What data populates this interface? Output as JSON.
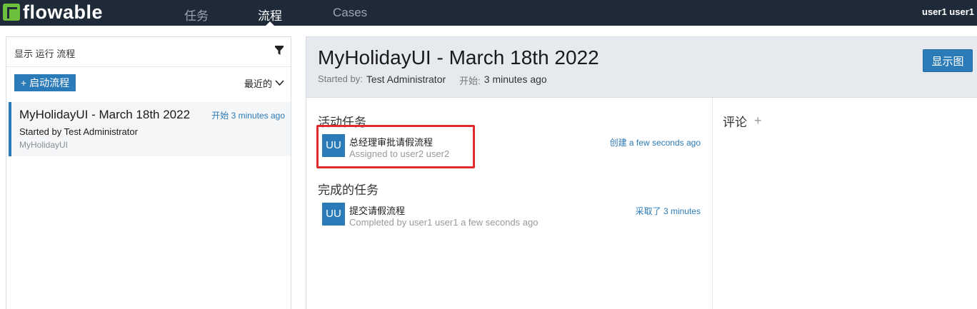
{
  "nav": {
    "brand": "flowable",
    "items": [
      {
        "label": "任务",
        "active": false
      },
      {
        "label": "流程",
        "active": true
      },
      {
        "label": "Cases",
        "active": false
      }
    ],
    "user": "user1 user1"
  },
  "sidebar": {
    "title": "显示 运行 流程",
    "start_button": "+ 启动流程",
    "sort_label": "最近的",
    "processes": [
      {
        "name": "MyHolidayUI - March 18th 2022",
        "start_label": "开始 3 minutes ago",
        "started_by": "Started by Test Administrator",
        "definition": "MyHolidayUI"
      }
    ]
  },
  "detail": {
    "title": "MyHolidayUI - March 18th 2022",
    "started_by_label": "Started by:",
    "started_by": "Test Administrator",
    "start_label": "开始:",
    "start_time": "3 minutes ago",
    "show_diagram_button": "显示图",
    "active_tasks_title": "活动任务",
    "active_tasks": [
      {
        "avatar": "UU",
        "name": "总经理审批请假流程",
        "sub": "Assigned to user2 user2",
        "time": "创建 a few seconds ago"
      }
    ],
    "completed_tasks_title": "完成的任务",
    "completed_tasks": [
      {
        "avatar": "UU",
        "name": "提交请假流程",
        "sub": "Completed by user1 user1 a few seconds ago",
        "time": "采取了 3 minutes"
      }
    ],
    "comments_title": "评论",
    "comments_add": "+"
  },
  "colors": {
    "nav_bg": "#1e2a38",
    "accent": "#2b7bb9",
    "highlight": "#e02b2b",
    "brand_green": "#6cbf3a"
  }
}
